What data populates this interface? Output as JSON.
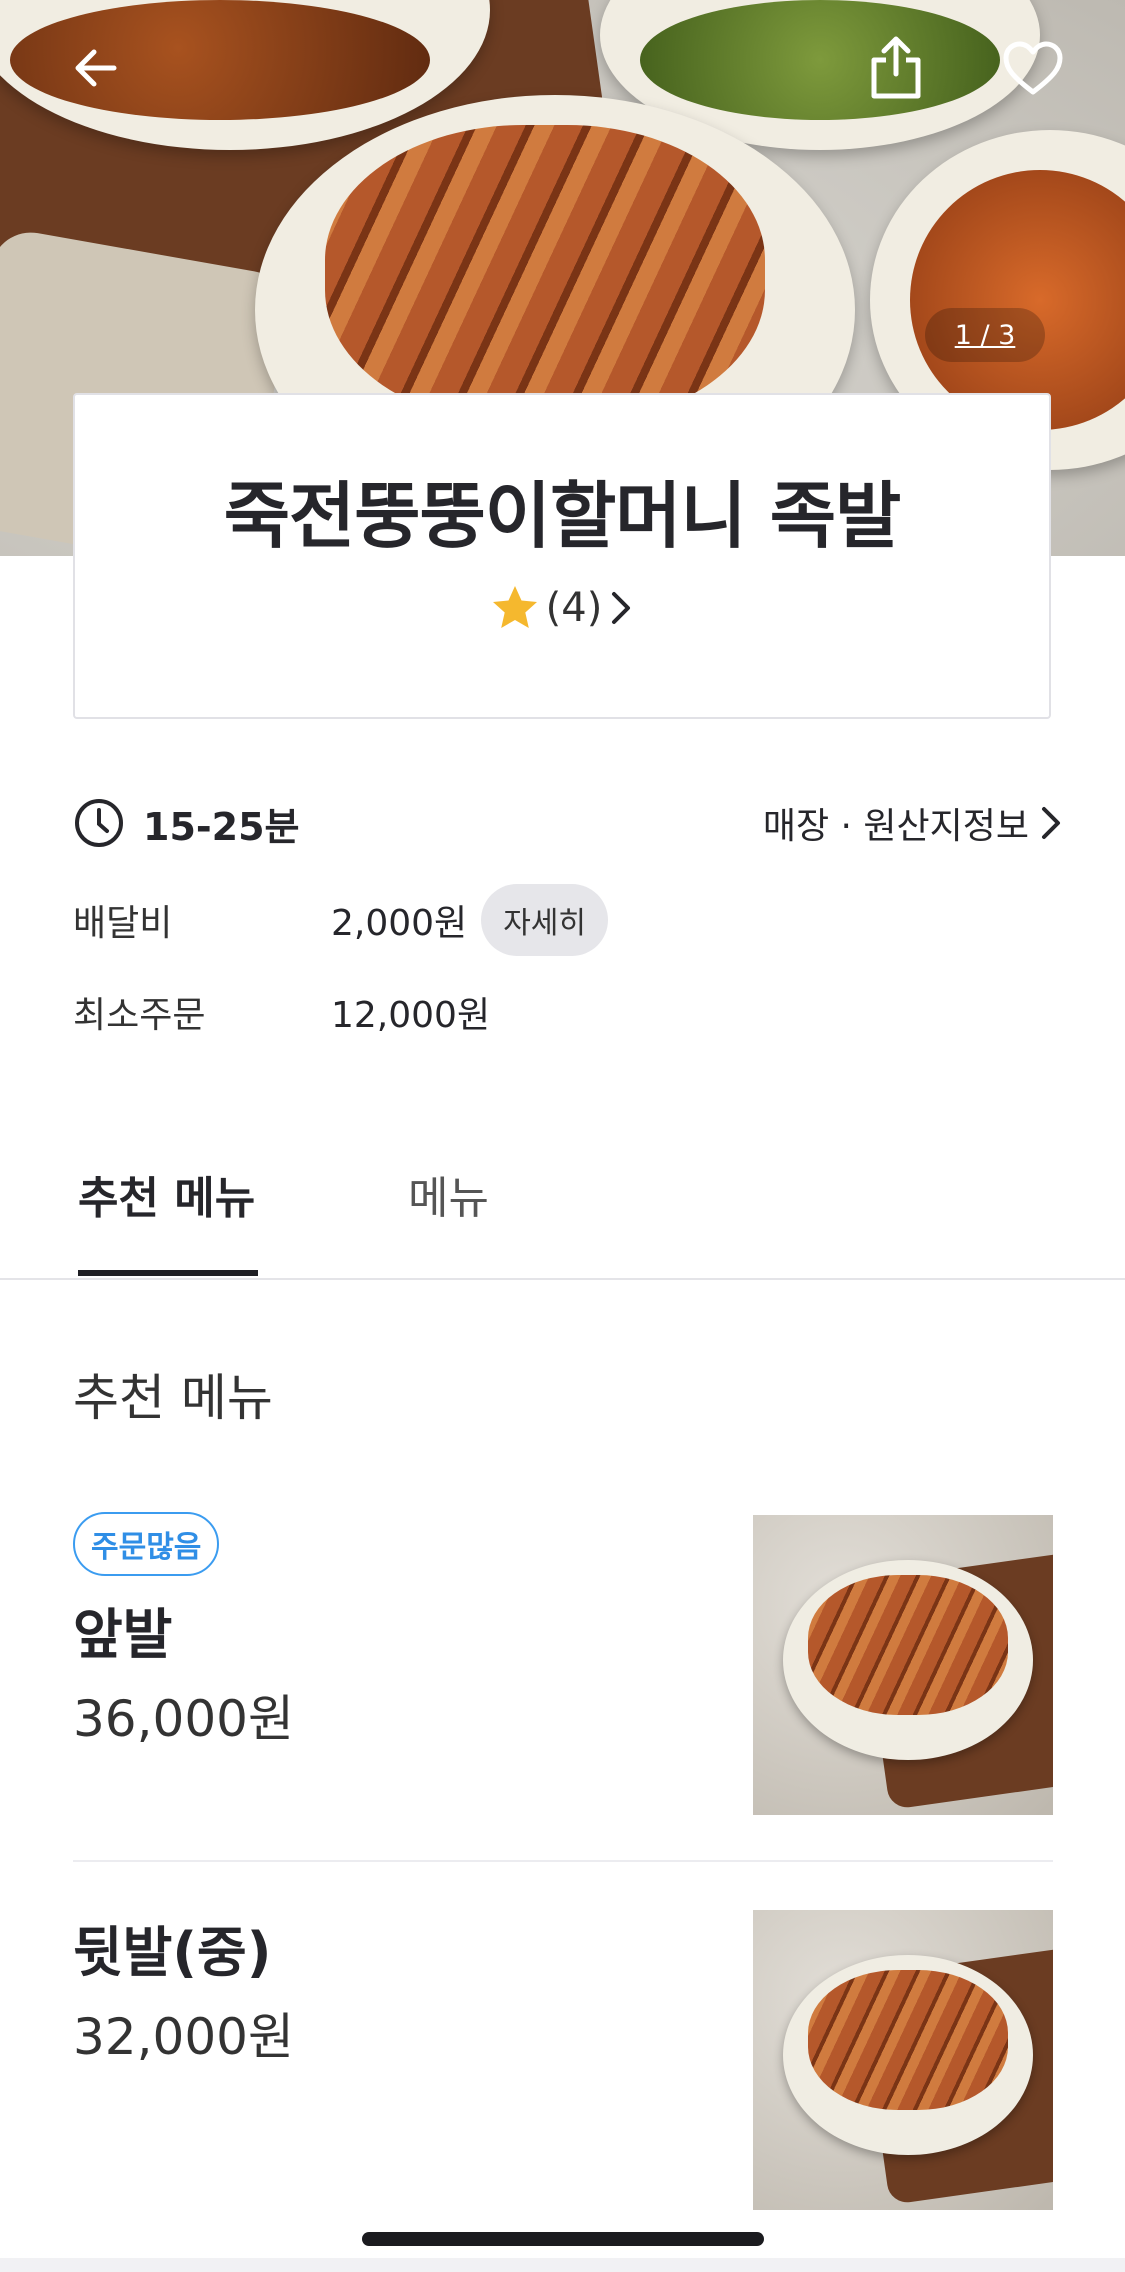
{
  "hero": {
    "image_counter": "1 / 3",
    "icons": {
      "back": "arrow-left-icon",
      "share": "share-icon",
      "favorite": "heart-outline-icon"
    }
  },
  "store": {
    "name": "죽전뚱뚱이할머니 족발",
    "rating_count": "(4)",
    "star_color": "#F5B82E"
  },
  "info": {
    "delivery_time": "15-25분",
    "store_info_link": "매장 · 원산지정보",
    "delivery_fee_label": "배달비",
    "delivery_fee_value": "2,000원",
    "detail_button": "자세히",
    "min_order_label": "최소주문",
    "min_order_value": "12,000원"
  },
  "tabs": [
    {
      "label": "추천 메뉴",
      "active": true
    },
    {
      "label": "메뉴",
      "active": false
    }
  ],
  "section_title": "추천 메뉴",
  "menu_items": [
    {
      "badge": "주문많음",
      "name": "앞발",
      "price": "36,000원"
    },
    {
      "badge": "",
      "name": "뒷발(중)",
      "price": "32,000원"
    }
  ],
  "colors": {
    "badge_blue": "#2F8EE6",
    "text_dark": "#26262B"
  }
}
